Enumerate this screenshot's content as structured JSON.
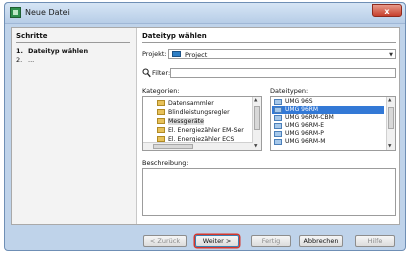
{
  "window": {
    "title": "Neue Datei",
    "close_glyph": "x"
  },
  "steps": {
    "title": "Schritte",
    "items": [
      {
        "num": "1.",
        "label": "Dateityp wählen"
      },
      {
        "num": "2.",
        "label": "..."
      }
    ]
  },
  "panel": {
    "title": "Dateityp wählen",
    "projekt_label": "Projekt:",
    "projekt_value": "Project",
    "filter_label": "Filter:",
    "filter_value": "",
    "kategorien_label": "Kategorien:",
    "kategorien": [
      "Datensammler",
      "Blindleistungsregler",
      "Messgeräte",
      "El. Energiezähler EM-Ser",
      "El. Energiezähler ECS"
    ],
    "kategorien_selected": "Messgeräte",
    "dateitypen_label": "Dateitypen:",
    "dateitypen": [
      "UMG 96S",
      "UMG 96RM",
      "UMG 96RM-CBM",
      "UMG 96RM-E",
      "UMG 96RM-P",
      "UMG 96RM-M"
    ],
    "dateitypen_selected": "UMG 96RM",
    "beschreibung_label": "Beschreibung:",
    "beschreibung_value": ""
  },
  "buttons": {
    "back": "< Zurück",
    "next": "Weiter >",
    "finish": "Fertig",
    "cancel": "Abbrechen",
    "help": "Hilfe"
  }
}
